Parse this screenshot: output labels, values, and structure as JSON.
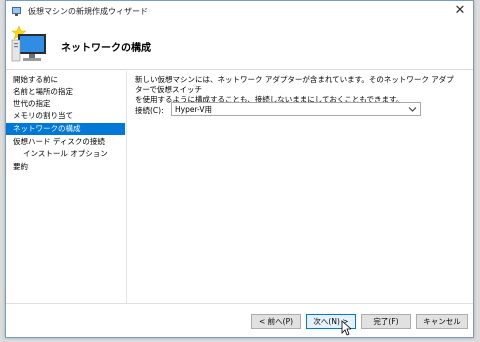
{
  "window": {
    "title": "仮想マシンの新規作成ウィザード",
    "close_glyph": "✕"
  },
  "header": {
    "title": "ネットワークの構成"
  },
  "sidebar": {
    "items": [
      {
        "label": "開始する前に"
      },
      {
        "label": "名前と場所の指定"
      },
      {
        "label": "世代の指定"
      },
      {
        "label": "メモリの割り当て"
      },
      {
        "label": "ネットワークの構成"
      },
      {
        "label": "仮想ハード ディスクの接続"
      },
      {
        "label": "インストール オプション"
      },
      {
        "label": "要約"
      }
    ],
    "active_index": 4
  },
  "content": {
    "description_line1": "新しい仮想マシンには、ネットワーク アダプターが含まれています。そのネットワーク アダプターで仮想スイッチ",
    "description_line2": "を使用するように構成することも、接続しないままにしておくこともできます。",
    "connection_label": "接続(C):",
    "connection_value": "Hyper-V用"
  },
  "buttons": {
    "previous": "< 前へ(P)",
    "next": "次へ(N) >",
    "finish": "完了(F)",
    "cancel": "キャンセル"
  },
  "colors": {
    "accent": "#0078d7",
    "window_border": "#7a9cc4"
  },
  "icons": [
    "hyperv-app-icon",
    "close-icon",
    "new-vm-wizard-icon",
    "chevron-down-icon",
    "mouse-cursor-icon"
  ]
}
